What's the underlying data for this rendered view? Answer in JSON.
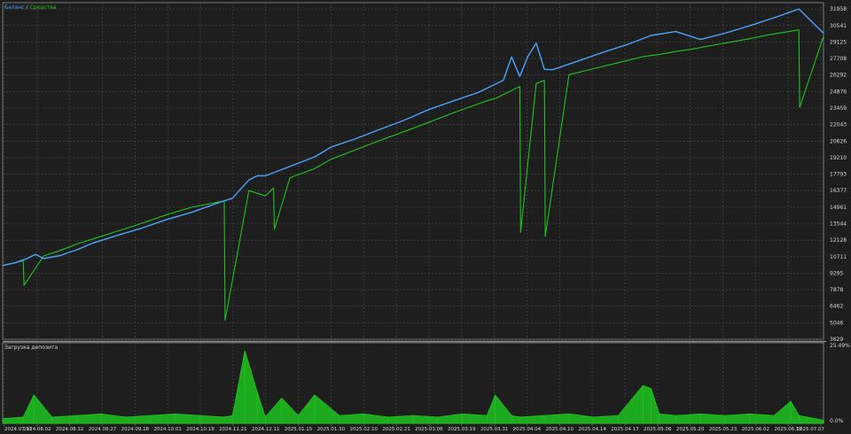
{
  "legend": {
    "balance": "Баланс",
    "separator": "/",
    "equity": "Средства"
  },
  "colors": {
    "background": "#1e1e1e",
    "grid": "#4a4a4a",
    "balance": "#4aa3ff",
    "equity": "#1fc31f",
    "load": "#1fc31f",
    "axis_text": "#d8d8d8",
    "border": "#7a7a7a"
  },
  "chart_data": [
    {
      "type": "line",
      "title": "",
      "ylim": [
        3630,
        32500
      ],
      "y_ticks": [
        "31958",
        "30541",
        "29125",
        "27708",
        "26292",
        "24876",
        "23459",
        "22043",
        "20626",
        "19210",
        "17793",
        "16377",
        "14961",
        "13544",
        "12128",
        "10711",
        "9295",
        "7878",
        "6462",
        "5046",
        "3629"
      ],
      "y_tick_values": [
        31958,
        30541,
        29125,
        27708,
        26292,
        24876,
        23459,
        22043,
        20626,
        19210,
        17793,
        16377,
        14961,
        13544,
        12128,
        10711,
        9295,
        7878,
        6462,
        5046,
        3629
      ],
      "grid": true,
      "legend_position": "top-left",
      "series": [
        {
          "name": "Баланс",
          "x": [
            0,
            1.5,
            3,
            4,
            5,
            7,
            9,
            11,
            14,
            17,
            20,
            23,
            26,
            28,
            30,
            31,
            32,
            35,
            38,
            40,
            43,
            46,
            49,
            52,
            55,
            58,
            61,
            62,
            63,
            64,
            65,
            66,
            67,
            70,
            73,
            76,
            79,
            82,
            85,
            88,
            91,
            94,
            97,
            100
          ],
          "values": [
            9950,
            10190,
            10560,
            10910,
            10550,
            10810,
            11290,
            11880,
            12540,
            13170,
            13900,
            14510,
            15260,
            15730,
            17300,
            17650,
            17650,
            18450,
            19270,
            20110,
            20830,
            21640,
            22430,
            23360,
            24090,
            24820,
            25850,
            27850,
            26180,
            27900,
            29030,
            26780,
            26750,
            27470,
            28210,
            28880,
            29690,
            30020,
            29340,
            29880,
            30520,
            31210,
            31960,
            29880
          ]
        },
        {
          "name": "Средства",
          "x": [
            0,
            2.5,
            2.6,
            5,
            7,
            9,
            12,
            15,
            17,
            20,
            23,
            27,
            27.1,
            30,
            32,
            33,
            33.1,
            35,
            38,
            40,
            43,
            46,
            49,
            52,
            55,
            58,
            59,
            60,
            61,
            63,
            63.1,
            65,
            66,
            66.1,
            69,
            72,
            75,
            78,
            80,
            82,
            84,
            86,
            88,
            91,
            93,
            95,
            97,
            97.1,
            100
          ],
          "values": [
            9950,
            10360,
            8250,
            10780,
            11240,
            11790,
            12460,
            13130,
            13580,
            14320,
            14950,
            15500,
            5260,
            16380,
            15920,
            16600,
            13050,
            17490,
            18260,
            19070,
            19880,
            20690,
            21460,
            22260,
            23080,
            23830,
            24080,
            24280,
            24620,
            25310,
            12790,
            25560,
            25840,
            12450,
            26320,
            26840,
            27350,
            27870,
            28060,
            28310,
            28520,
            28780,
            29030,
            29410,
            29700,
            29930,
            30170,
            23510,
            29620
          ]
        }
      ]
    },
    {
      "type": "bar",
      "title": "Загрузка депозита",
      "ylim": [
        0,
        25.49
      ],
      "y_ticks": [
        "25.49%",
        "0.0%"
      ],
      "y_tick_values": [
        25.49,
        0
      ],
      "categories": [
        "2024.07.11",
        "2024.08.02",
        "2024.08.12",
        "2024.08.27",
        "2024.09.18",
        "2024.10.01",
        "2024.10.18",
        "2024.11.21",
        "2024.12.11",
        "2025.01.15",
        "2025.01.30",
        "2025.02.10",
        "2025.02.21",
        "2025.03.06",
        "2025.03.19",
        "2025.03.31",
        "2025.04.04",
        "2025.04.10",
        "2025.04.14",
        "2025.04.17",
        "2025.05.06",
        "2025.05.20",
        "2025.05.23",
        "2025.06.02",
        "2025.06.12",
        "2025.07.07"
      ],
      "x": [
        0,
        2.5,
        3.8,
        6,
        9,
        12,
        15,
        18,
        21,
        24,
        27,
        28,
        29.5,
        31,
        32,
        34,
        36,
        38,
        41,
        44,
        47,
        50,
        53,
        56,
        59,
        60,
        62,
        63,
        66,
        69,
        72,
        75,
        78,
        79,
        80,
        82,
        85,
        88,
        91,
        94,
        96,
        97,
        98,
        100
      ],
      "values": [
        1.5,
        2,
        9,
        2,
        2.5,
        3,
        2,
        2.5,
        3,
        2.5,
        2,
        2.5,
        23,
        10,
        2,
        8,
        2.5,
        9,
        2.5,
        3,
        2,
        2.5,
        2,
        3,
        2.5,
        9,
        2.5,
        2,
        2.5,
        3,
        2,
        2.5,
        12,
        11,
        3,
        2.5,
        3,
        2.5,
        3,
        2.5,
        7,
        2.5,
        2,
        1
      ]
    }
  ]
}
